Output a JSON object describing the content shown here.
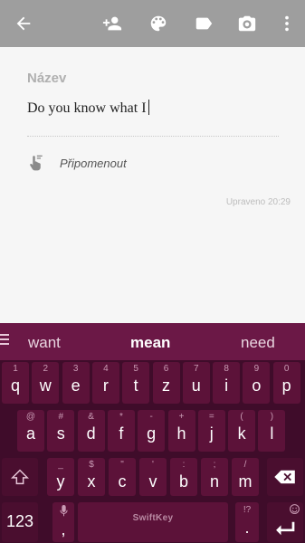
{
  "toolbar": {
    "icons": [
      "back-arrow-icon",
      "add-collaborator-icon",
      "palette-icon",
      "label-icon",
      "camera-icon",
      "more-vertical-icon"
    ]
  },
  "note": {
    "title_placeholder": "Název",
    "body_text": "Do you know what I",
    "reminder_label": "Připomenout",
    "edited_text": "Upraveno 20:29"
  },
  "keyboard": {
    "suggestions": [
      "want",
      "mean",
      "need"
    ],
    "selected_suggestion": "mean",
    "row1": [
      {
        "main": "q",
        "hint": "1"
      },
      {
        "main": "w",
        "hint": "2"
      },
      {
        "main": "e",
        "hint": "3"
      },
      {
        "main": "r",
        "hint": "4"
      },
      {
        "main": "t",
        "hint": "5"
      },
      {
        "main": "z",
        "hint": "6"
      },
      {
        "main": "u",
        "hint": "7"
      },
      {
        "main": "i",
        "hint": "8"
      },
      {
        "main": "o",
        "hint": "9"
      },
      {
        "main": "p",
        "hint": "0"
      }
    ],
    "row2": [
      {
        "main": "a",
        "hint": "@"
      },
      {
        "main": "s",
        "hint": "#"
      },
      {
        "main": "d",
        "hint": "&"
      },
      {
        "main": "f",
        "hint": "*"
      },
      {
        "main": "g",
        "hint": "-"
      },
      {
        "main": "h",
        "hint": "+"
      },
      {
        "main": "j",
        "hint": "="
      },
      {
        "main": "k",
        "hint": "("
      },
      {
        "main": "l",
        "hint": ")"
      }
    ],
    "row3": [
      {
        "main": "y",
        "hint": "_"
      },
      {
        "main": "x",
        "hint": "$"
      },
      {
        "main": "c",
        "hint": "\""
      },
      {
        "main": "v",
        "hint": "'"
      },
      {
        "main": "b",
        "hint": ":"
      },
      {
        "main": "n",
        "hint": ";"
      },
      {
        "main": "m",
        "hint": "/"
      }
    ],
    "numbers_key": "123",
    "comma_key": ",",
    "period_key": ".",
    "period_hint": "!?",
    "space_brand": "SwiftKey",
    "colors": {
      "suggestion_bar": "#6b1846",
      "key": "#5c1239",
      "keyboard_bg": "#3f0c2a",
      "toolbar": "#9e9e9e"
    }
  }
}
